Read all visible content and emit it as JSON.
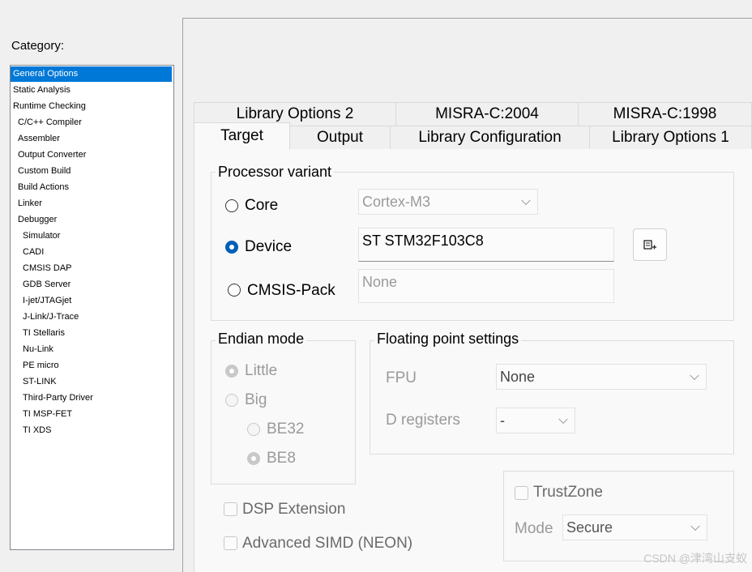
{
  "category": {
    "label": "Category:",
    "items": [
      {
        "label": "General Options",
        "indent": 0,
        "selected": true
      },
      {
        "label": "Static Analysis",
        "indent": 0
      },
      {
        "label": "Runtime Checking",
        "indent": 0
      },
      {
        "label": "C/C++ Compiler",
        "indent": 1
      },
      {
        "label": "Assembler",
        "indent": 1
      },
      {
        "label": "Output Converter",
        "indent": 1
      },
      {
        "label": "Custom Build",
        "indent": 1
      },
      {
        "label": "Build Actions",
        "indent": 1
      },
      {
        "label": "Linker",
        "indent": 1
      },
      {
        "label": "Debugger",
        "indent": 1
      },
      {
        "label": "Simulator",
        "indent": 2
      },
      {
        "label": "CADI",
        "indent": 2
      },
      {
        "label": "CMSIS DAP",
        "indent": 2
      },
      {
        "label": "GDB Server",
        "indent": 2
      },
      {
        "label": "I-jet/JTAGjet",
        "indent": 2
      },
      {
        "label": "J-Link/J-Trace",
        "indent": 2
      },
      {
        "label": "TI Stellaris",
        "indent": 2
      },
      {
        "label": "Nu-Link",
        "indent": 2
      },
      {
        "label": "PE micro",
        "indent": 2
      },
      {
        "label": "ST-LINK",
        "indent": 2
      },
      {
        "label": "Third-Party Driver",
        "indent": 2
      },
      {
        "label": "TI MSP-FET",
        "indent": 2
      },
      {
        "label": "TI XDS",
        "indent": 2
      }
    ]
  },
  "tabs": {
    "row_back": [
      "Library Options 2",
      "MISRA-C:2004",
      "MISRA-C:1998"
    ],
    "row_front": [
      "Target",
      "Output",
      "Library Configuration",
      "Library Options 1"
    ],
    "active": "Target"
  },
  "processor_variant": {
    "title": "Processor variant",
    "core_label": "Core",
    "core_value": "Cortex-M3",
    "device_label": "Device",
    "device_value": "ST STM32F103C8",
    "cmsis_label": "CMSIS-Pack",
    "cmsis_value": "None",
    "selected": "Device"
  },
  "endian": {
    "title": "Endian mode",
    "little": "Little",
    "big": "Big",
    "be32": "BE32",
    "be8": "BE8"
  },
  "floating_point": {
    "title": "Floating point settings",
    "fpu_label": "FPU",
    "fpu_value": "None",
    "dreg_label": "D registers",
    "dreg_value": "-"
  },
  "extensions": {
    "dsp": "DSP Extension",
    "neon": "Advanced SIMD (NEON)"
  },
  "trustzone": {
    "label": "TrustZone",
    "mode_label": "Mode",
    "mode_value": "Secure"
  },
  "watermark": "CSDN @津湾山支蚁",
  "colors": {
    "selection": "#0078d7",
    "radio_checked": "#005fb8",
    "disabled_text": "#9a9a9a"
  }
}
